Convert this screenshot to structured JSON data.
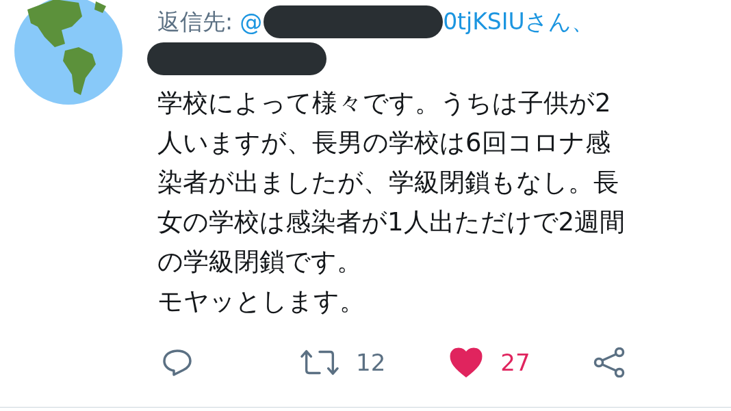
{
  "reply_to": {
    "label": "返信先:",
    "mention_start": "@",
    "mention_end": "0tjKSIUさん、"
  },
  "body_lines": [
    "学校によって様々です。うちは子供が2",
    "人いますが、長男の学校は6回コロナ感",
    "染者が出ましたが、学級閉鎖もなし。長",
    "女の学校は感染者が1人出ただけで2週間",
    "の学級閉鎖です。",
    "モヤッとします。"
  ],
  "actions": {
    "retweets": {
      "count": "12",
      "selected": false
    },
    "likes": {
      "count": "27",
      "selected": true
    }
  }
}
